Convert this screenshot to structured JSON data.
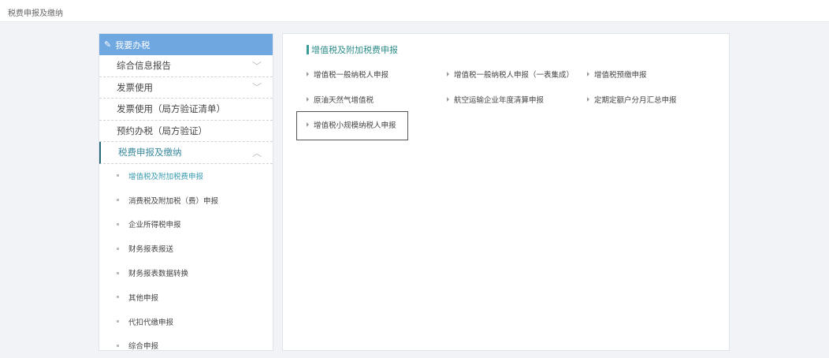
{
  "breadcrumb": "税费申报及缴纳",
  "sidebar": {
    "header": "我要办税",
    "menus": [
      "综合信息报告",
      "发票使用",
      "发票使用（局方验证清单）",
      "预约办税（局方验证）",
      "税费申报及缴纳"
    ],
    "sub": [
      "增值税及附加税费申报",
      "消费税及附加税（费）申报",
      "企业所得税申报",
      "财务报表报送",
      "财务报表数据转换",
      "其他申报",
      "代扣代缴申报",
      "综合申报"
    ]
  },
  "main": {
    "title": "增值税及附加税费申报",
    "items": [
      "增值税一般纳税人申报",
      "增值税一般纳税人申报（一表集成）",
      "增值税预缴申报",
      "原油天然气增值税",
      "航空运输企业年度清算申报",
      "定期定额户分月汇总申报",
      "增值税小规模纳税人申报"
    ]
  }
}
